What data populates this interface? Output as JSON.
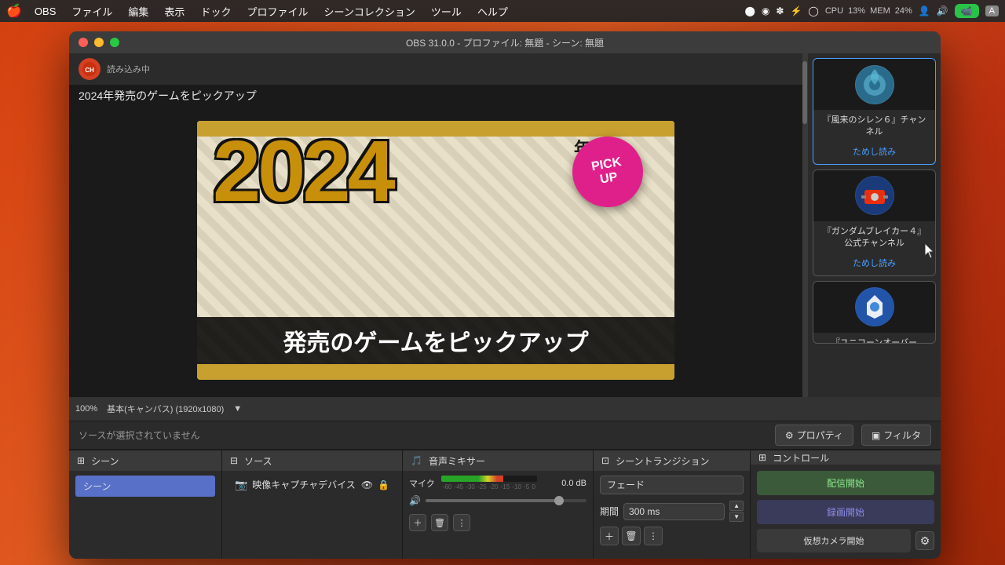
{
  "menubar": {
    "apple": "🍎",
    "items": [
      "OBS",
      "ファイル",
      "編集",
      "表示",
      "ドック",
      "プロファイル",
      "シーンコレクション",
      "ツール",
      "ヘルプ"
    ],
    "cpu_label": "CPU",
    "cpu_value": "13%",
    "mem_label": "MEM",
    "mem_value": "24%",
    "camera_btn": "📷"
  },
  "window": {
    "title": "OBS 31.0.0 - プロファイル: 無題 - シーン: 無題"
  },
  "preview": {
    "channel_name": "読み込み中",
    "heading": "2024年発売のゲームをピックアップ",
    "year_text": "2024",
    "kanji_text": "発売のゲームをピックアップ",
    "pickup_line1": "PICK",
    "pickup_line2": "UP"
  },
  "sidebar_cards": [
    {
      "name": "『風来のシレン６』チャンネル",
      "link": "ためし読み",
      "bg": "#3a7a9a",
      "active": true
    },
    {
      "name": "『ガンダムブレイカー４』公式チャンネル",
      "link": "ためし読み",
      "bg": "#2a4a8a",
      "active": false
    },
    {
      "name": "『ユニコーンオーバー",
      "link": "",
      "bg": "#2a5aaa",
      "active": false
    }
  ],
  "status_bar": {
    "zoom": "100%",
    "canvas": "基本(キャンバス) (1920x1080)"
  },
  "source_bar": {
    "no_source_text": "ソースが選択されていません",
    "properties_btn": "プロパティ",
    "filter_btn": "フィルタ"
  },
  "panels": {
    "scene": {
      "title": "シーン",
      "items": [
        "シーン"
      ]
    },
    "source": {
      "title": "ソース",
      "items": [
        "映像キャプチャデバイス"
      ]
    },
    "audio": {
      "title": "音声ミキサー",
      "mic_label": "マイク",
      "mic_db": "0.0 dB",
      "scale_labels": [
        "-60",
        "-45",
        "-30",
        "-25",
        "-20",
        "-15",
        "-10",
        "-5",
        "0"
      ]
    },
    "transition": {
      "title": "シーントランジション",
      "type": "フェード",
      "duration_label": "期間",
      "duration_value": "300 ms"
    },
    "controls": {
      "title": "コントロール",
      "stream_btn": "配信開始",
      "record_btn": "録画開始",
      "virtual_cam_btn": "仮想カメラ開始"
    }
  }
}
